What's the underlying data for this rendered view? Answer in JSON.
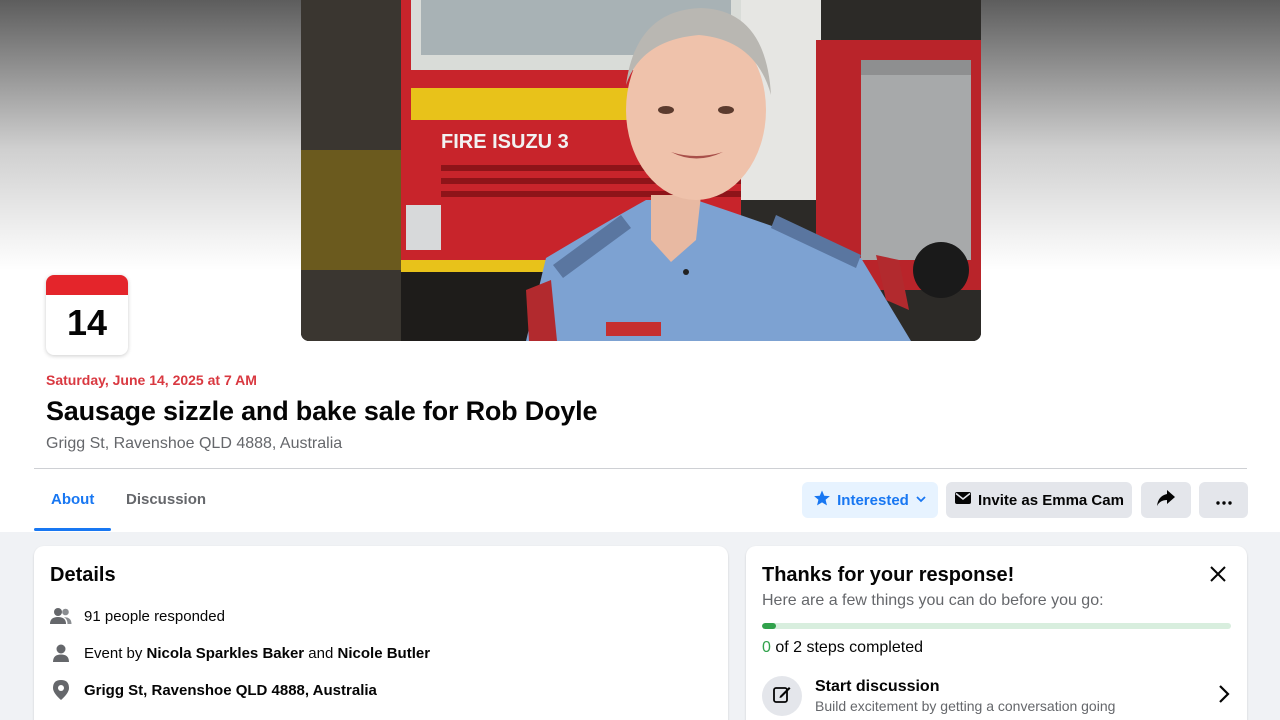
{
  "event": {
    "day_number": "14",
    "date_text": "Saturday, June 14, 2025 at 7 AM",
    "title": "Sausage sizzle and bake sale for Rob Doyle",
    "location": "Grigg St, Ravenshoe QLD 4888, Australia"
  },
  "cover": {
    "truck_lettering": "FIRE ISUZU 3"
  },
  "tabs": [
    {
      "label": "About",
      "active": true
    },
    {
      "label": "Discussion",
      "active": false
    }
  ],
  "actions": {
    "interested_label": "Interested",
    "invite_label": "Invite as Emma Cam"
  },
  "details": {
    "title": "Details",
    "responded": "91 people responded",
    "event_by_prefix": "Event by ",
    "host1": "Nicola Sparkles Baker",
    "and_text": " and ",
    "host2": "Nicole Butler",
    "location": "Grigg St, Ravenshoe QLD 4888, Australia"
  },
  "response_card": {
    "title": "Thanks for your response!",
    "subtitle": "Here are a few things you can do before you go:",
    "progress_fraction": 0.03,
    "steps_done": "0",
    "steps_text": " of 2 steps completed",
    "task_title": "Start discussion",
    "task_desc": "Build excitement by getting a conversation going"
  },
  "colors": {
    "accent": "#1877f2",
    "date_red": "#d93840",
    "progress_green": "#31a24c"
  }
}
